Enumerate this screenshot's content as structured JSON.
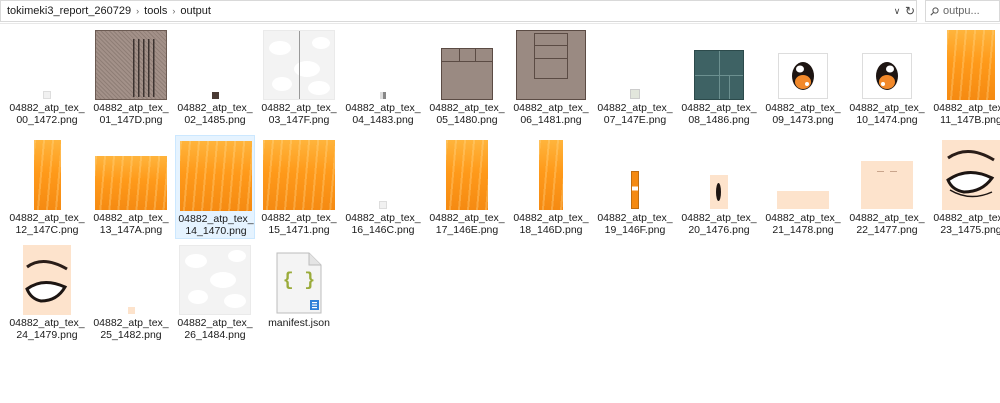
{
  "breadcrumb": [
    "tokimeki3_report_260729",
    "tools",
    "output"
  ],
  "search": {
    "placeholder": "outpu..."
  },
  "files": [
    {
      "name": "04882_atp_tex_00_1472.png"
    },
    {
      "name": "04882_atp_tex_01_147D.png"
    },
    {
      "name": "04882_atp_tex_02_1485.png"
    },
    {
      "name": "04882_atp_tex_03_147F.png"
    },
    {
      "name": "04882_atp_tex_04_1483.png"
    },
    {
      "name": "04882_atp_tex_05_1480.png"
    },
    {
      "name": "04882_atp_tex_06_1481.png"
    },
    {
      "name": "04882_atp_tex_07_147E.png"
    },
    {
      "name": "04882_atp_tex_08_1486.png"
    },
    {
      "name": "04882_atp_tex_09_1473.png"
    },
    {
      "name": "04882_atp_tex_10_1474.png"
    },
    {
      "name": "04882_atp_tex_11_147B.png"
    },
    {
      "name": "04882_atp_tex_12_147C.png"
    },
    {
      "name": "04882_atp_tex_13_147A.png"
    },
    {
      "name": "04882_atp_tex_14_1470.png",
      "selected": true
    },
    {
      "name": "04882_atp_tex_15_1471.png"
    },
    {
      "name": "04882_atp_tex_16_146C.png"
    },
    {
      "name": "04882_atp_tex_17_146E.png"
    },
    {
      "name": "04882_atp_tex_18_146D.png"
    },
    {
      "name": "04882_atp_tex_19_146F.png"
    },
    {
      "name": "04882_atp_tex_20_1476.png"
    },
    {
      "name": "04882_atp_tex_21_1478.png"
    },
    {
      "name": "04882_atp_tex_22_1477.png"
    },
    {
      "name": "04882_atp_tex_23_1475.png"
    },
    {
      "name": "04882_atp_tex_24_1479.png"
    },
    {
      "name": "04882_atp_tex_25_1482.png"
    },
    {
      "name": "04882_atp_tex_26_1484.png"
    },
    {
      "name": "manifest.json"
    }
  ]
}
